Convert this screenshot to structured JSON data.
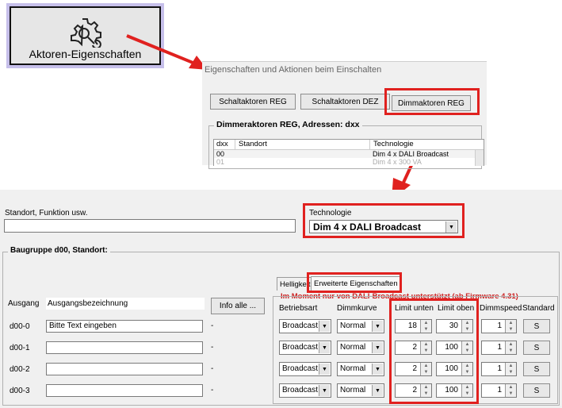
{
  "toolbar": {
    "button_label": "Aktoren-Eigenschaften",
    "icon": "gear-wrench-icon"
  },
  "dialog": {
    "caption": "Eigenschaften und Aktionen beim Einschalten",
    "tabs": [
      "Schaltaktoren REG",
      "Schaltaktoren DEZ",
      "Dimmaktoren REG"
    ],
    "group_title": "Dimmeraktoren REG, Adressen: dxx",
    "list": {
      "headers": [
        "dxx",
        "Standort",
        "Technologie"
      ],
      "rows": [
        {
          "dxx": "00",
          "standort": "",
          "technologie": "Dim 4 x DALI Broadcast"
        },
        {
          "dxx": "01",
          "standort": "",
          "technologie": "Dim 4 x 300 VA"
        }
      ]
    }
  },
  "panel": {
    "standort_label": "Standort, Funktion usw.",
    "standort_value": "",
    "technologie_label": "Technologie",
    "technologie_value": "Dim 4 x DALI Broadcast",
    "group_title": "Baugruppe d00, Standort:",
    "tabs": [
      "Helligkeit",
      "Erweiterte Eigenschaften"
    ],
    "notice": "Im Moment nur von DALI-Broadcast unterstützt (ab Firmware 4.31)",
    "ausgang_header": "Ausgang",
    "bezeichnung_header": "Ausgangsbezeichnung",
    "info_button": "Info alle ...",
    "columns": [
      "Betriebsart",
      "Dimmkurve",
      "Limit unten",
      "Limit oben",
      "Dimmspeed",
      "Standard"
    ],
    "rows": [
      {
        "ausgang": "d00-0",
        "bezeichnung": "Bitte Text eingeben",
        "info": "-",
        "betriebsart": "Broadcast",
        "dimmkurve": "Normal",
        "limit_unten": "18",
        "limit_oben": "30",
        "dimmspeed": "1",
        "standard": "S"
      },
      {
        "ausgang": "d00-1",
        "bezeichnung": "",
        "info": "-",
        "betriebsart": "Broadcast",
        "dimmkurve": "Normal",
        "limit_unten": "2",
        "limit_oben": "100",
        "dimmspeed": "1",
        "standard": "S"
      },
      {
        "ausgang": "d00-2",
        "bezeichnung": "",
        "info": "-",
        "betriebsart": "Broadcast",
        "dimmkurve": "Normal",
        "limit_unten": "2",
        "limit_oben": "100",
        "dimmspeed": "1",
        "standard": "S"
      },
      {
        "ausgang": "d00-3",
        "bezeichnung": "",
        "info": "-",
        "betriebsart": "Broadcast",
        "dimmkurve": "Normal",
        "limit_unten": "2",
        "limit_oben": "100",
        "dimmspeed": "1",
        "standard": "S"
      }
    ]
  },
  "colors": {
    "highlight": "#e0211f",
    "button_frame": "#c6bfea",
    "notice": "#cc2222"
  }
}
